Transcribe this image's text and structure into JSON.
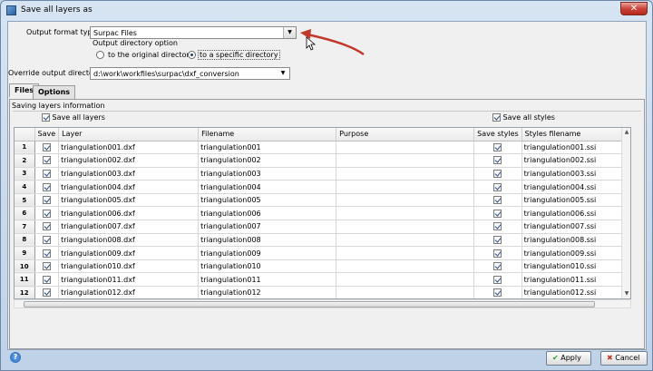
{
  "window": {
    "title": "Save all layers as"
  },
  "form": {
    "output_format_label": "Output format type",
    "output_format_value": "Surpac Files",
    "output_dir_option_label": "Output directory option",
    "radio_original": "to the original directory",
    "radio_specific": "to a specific directory",
    "override_dir_label": "Override output directory",
    "override_dir_value": "d:\\work\\workfiles\\surpac\\dxf_conversion"
  },
  "tabs": [
    {
      "label": "Files"
    },
    {
      "label": "Options"
    }
  ],
  "files": {
    "section_label": "Saving layers information",
    "save_all_layers": "Save all layers",
    "save_all_styles": "Save all styles",
    "columns": [
      "Save",
      "Layer",
      "Filename",
      "Purpose",
      "Save styles",
      "Styles filename"
    ],
    "rows": [
      {
        "n": "1",
        "layer": "triangulation001.dxf",
        "filename": "triangulation001",
        "purpose": "",
        "styles": "triangulation001.ssi"
      },
      {
        "n": "2",
        "layer": "triangulation002.dxf",
        "filename": "triangulation002",
        "purpose": "",
        "styles": "triangulation002.ssi"
      },
      {
        "n": "3",
        "layer": "triangulation003.dxf",
        "filename": "triangulation003",
        "purpose": "",
        "styles": "triangulation003.ssi"
      },
      {
        "n": "4",
        "layer": "triangulation004.dxf",
        "filename": "triangulation004",
        "purpose": "",
        "styles": "triangulation004.ssi"
      },
      {
        "n": "5",
        "layer": "triangulation005.dxf",
        "filename": "triangulation005",
        "purpose": "",
        "styles": "triangulation005.ssi"
      },
      {
        "n": "6",
        "layer": "triangulation006.dxf",
        "filename": "triangulation006",
        "purpose": "",
        "styles": "triangulation006.ssi"
      },
      {
        "n": "7",
        "layer": "triangulation007.dxf",
        "filename": "triangulation007",
        "purpose": "",
        "styles": "triangulation007.ssi"
      },
      {
        "n": "8",
        "layer": "triangulation008.dxf",
        "filename": "triangulation008",
        "purpose": "",
        "styles": "triangulation008.ssi"
      },
      {
        "n": "9",
        "layer": "triangulation009.dxf",
        "filename": "triangulation009",
        "purpose": "",
        "styles": "triangulation009.ssi"
      },
      {
        "n": "10",
        "layer": "triangulation010.dxf",
        "filename": "triangulation010",
        "purpose": "",
        "styles": "triangulation010.ssi"
      },
      {
        "n": "11",
        "layer": "triangulation011.dxf",
        "filename": "triangulation011",
        "purpose": "",
        "styles": "triangulation011.ssi"
      },
      {
        "n": "12",
        "layer": "triangulation012.dxf",
        "filename": "triangulation012",
        "purpose": "",
        "styles": "triangulation012.ssi"
      }
    ]
  },
  "footer": {
    "apply": "Apply",
    "cancel": "Cancel"
  },
  "icons": {
    "help": "help-icon",
    "apply": "check-icon",
    "cancel": "x-icon",
    "annotation": "red-arrow-annotation"
  },
  "colors": {
    "annotation_arrow": "#c0392b",
    "checkmark": "#2b4d8a"
  }
}
